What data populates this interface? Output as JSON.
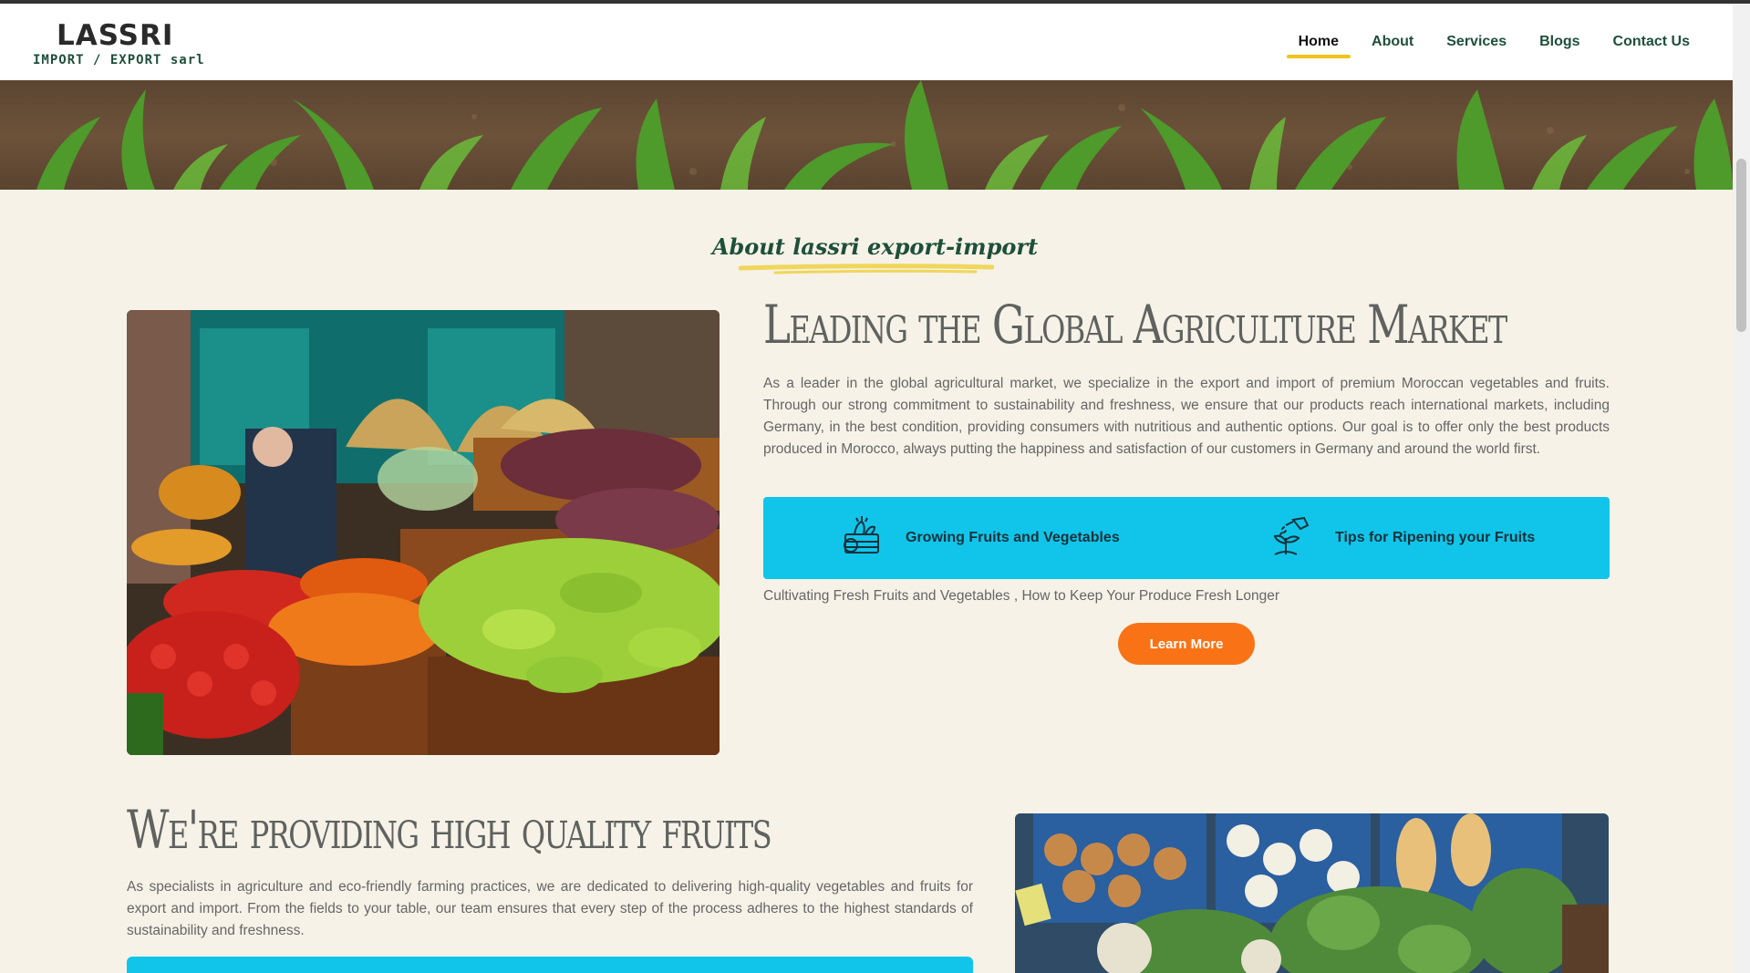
{
  "header": {
    "logo_main": "LASSRI",
    "logo_sub": "IMPORT / EXPORT sarl",
    "nav": [
      {
        "label": "Home",
        "active": true
      },
      {
        "label": "About",
        "active": false
      },
      {
        "label": "Services",
        "active": false
      },
      {
        "label": "Blogs",
        "active": false
      },
      {
        "label": "Contact Us",
        "active": false
      }
    ]
  },
  "about": {
    "section_title": "About lassri export-import",
    "heading": "Leading the Global Agriculture Market",
    "paragraph": "As a leader in the global agricultural market, we specialize in the export and import of premium Moroccan vegetables and fruits. Through our strong commitment to sustainability and freshness, we ensure that our products reach international markets, including Germany, in the best condition, providing consumers with nutritious and authentic options. Our goal is to offer only the best products produced in Morocco, always putting the happiness and satisfaction of our customers in Germany and around the world first.",
    "features": [
      {
        "label": "Growing Fruits and Vegetables",
        "icon": "basket-icon"
      },
      {
        "label": "Tips for Ripening your Fruits",
        "icon": "watering-plant-icon"
      }
    ],
    "sub_text": "Cultivating Fresh Fruits and Vegetables , How to Keep Your Produce Fresh Longer",
    "button": "Learn More"
  },
  "quality": {
    "heading": "We're providing high quality fruits",
    "paragraph": "As specialists in agriculture and eco-friendly farming practices, we are dedicated to delivering high-quality vegetables and fruits for export and import. From the fields to your table, our team ensures that every step of the process adheres to the highest standards of sustainability and freshness."
  },
  "colors": {
    "brand_green": "#1e4f3a",
    "accent_blue": "#11c5ea",
    "accent_orange": "#f97316",
    "accent_yellow": "#f0c419",
    "background": "#f6f2e7"
  }
}
